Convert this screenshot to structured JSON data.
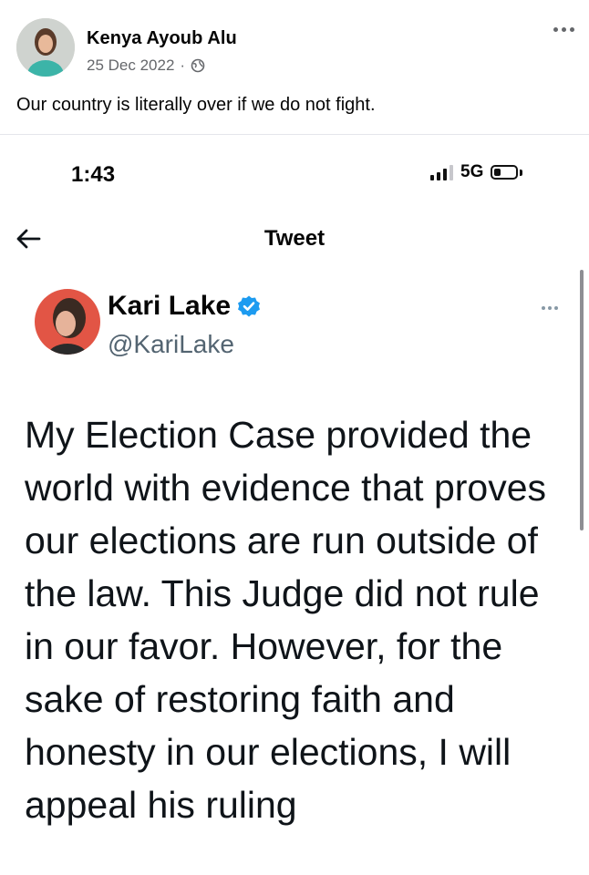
{
  "post": {
    "author": "Kenya Ayoub Alu",
    "date": "25 Dec 2022",
    "separator": "·",
    "audience_icon": "globe-icon",
    "text": "Our country is literally over if we do not fight."
  },
  "screenshot": {
    "status_bar": {
      "time": "1:43",
      "network": "5G",
      "signal_bars_filled": 3,
      "signal_bars_total": 4,
      "battery_level": 0.3
    },
    "nav": {
      "title": "Tweet"
    },
    "tweet": {
      "name": "Kari Lake",
      "handle": "@KariLake",
      "verified": true,
      "verified_color": "#1d9bf0",
      "body": "My Election Case provided the world with evidence that proves our elections are run outside of the law. This Judge did not rule in our favor. However, for the sake of restoring faith and honesty in our elections, I will appeal his ruling"
    }
  }
}
